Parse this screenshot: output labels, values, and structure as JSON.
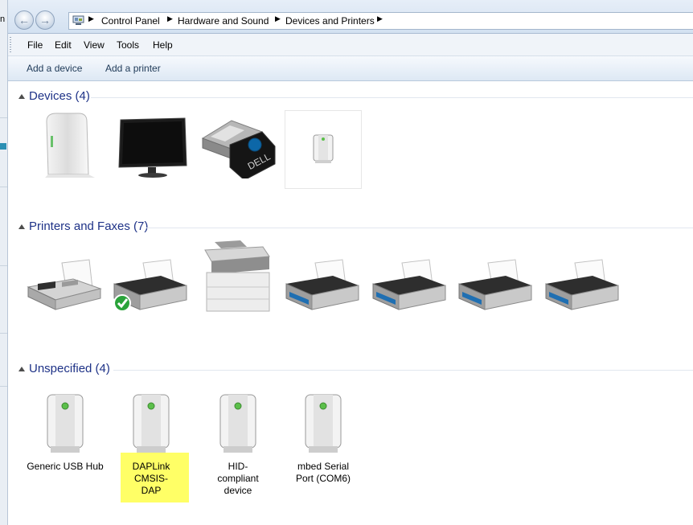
{
  "window": {
    "edge_char": "n",
    "accent_color": "#1e3287",
    "highlight_color": "#ffff66"
  },
  "nav": {
    "back_icon": "back-arrow-icon",
    "forward_icon": "forward-arrow-icon",
    "location_icon": "control-panel-icon"
  },
  "breadcrumb": [
    "Control Panel",
    "Hardware and Sound",
    "Devices and Printers"
  ],
  "menu": [
    "File",
    "Edit",
    "View",
    "Tools",
    "Help"
  ],
  "commands": [
    "Add a device",
    "Add a printer"
  ],
  "groups": [
    {
      "title": "Devices (4)",
      "items": [
        {
          "icon": "external-drive-icon",
          "label": ""
        },
        {
          "icon": "monitor-icon",
          "label": ""
        },
        {
          "icon": "usb-receiver-icon",
          "label": ""
        },
        {
          "icon": "generic-device-icon",
          "label": ""
        }
      ]
    },
    {
      "title": "Printers and Faxes (7)",
      "items": [
        {
          "icon": "fax-icon",
          "label": ""
        },
        {
          "icon": "default-printer-icon",
          "label": ""
        },
        {
          "icon": "multifunction-printer-icon",
          "label": ""
        },
        {
          "icon": "printer-icon",
          "label": ""
        },
        {
          "icon": "printer-icon",
          "label": ""
        },
        {
          "icon": "printer-icon",
          "label": ""
        },
        {
          "icon": "printer-icon",
          "label": ""
        }
      ]
    },
    {
      "title": "Unspecified (4)",
      "items": [
        {
          "icon": "generic-device-icon",
          "label": "Generic USB Hub"
        },
        {
          "icon": "generic-device-icon",
          "label": "DAPLink CMSIS-DAP",
          "highlighted": true
        },
        {
          "icon": "generic-device-icon",
          "label": "HID-compliant device"
        },
        {
          "icon": "generic-device-icon",
          "label": "mbed Serial Port (COM6)"
        }
      ]
    }
  ]
}
